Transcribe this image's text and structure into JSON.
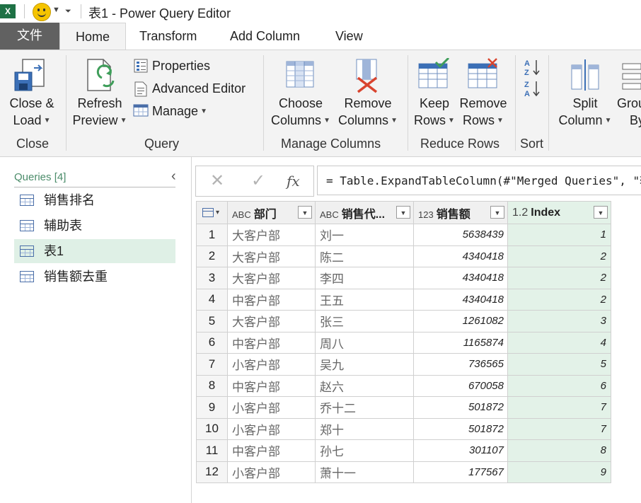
{
  "titlebar": {
    "app_icon": "X",
    "title": "表1 - Power Query Editor"
  },
  "tabs": {
    "file": "文件",
    "items": [
      "Home",
      "Transform",
      "Add Column",
      "View"
    ],
    "active": "Home"
  },
  "ribbon": {
    "close_load": [
      "Close &",
      "Load"
    ],
    "refresh_preview": [
      "Refresh",
      "Preview"
    ],
    "properties": "Properties",
    "advanced_editor": "Advanced Editor",
    "manage": "Manage",
    "choose_columns": [
      "Choose",
      "Columns"
    ],
    "remove_columns": [
      "Remove",
      "Columns"
    ],
    "keep_rows": [
      "Keep",
      "Rows"
    ],
    "remove_rows": [
      "Remove",
      "Rows"
    ],
    "split_column": [
      "Split",
      "Column"
    ],
    "group_by": [
      "Grou",
      "By"
    ],
    "groups": {
      "close": "Close",
      "query": "Query",
      "manage_columns": "Manage Columns",
      "reduce_rows": "Reduce Rows",
      "sort": "Sort"
    }
  },
  "queries": {
    "header": "Queries [4]",
    "items": [
      "销售排名",
      "辅助表",
      "表1",
      "销售额去重"
    ],
    "selected": "表1"
  },
  "formula": {
    "text": "= Table.ExpandTableColumn(#\"Merged Queries\", \"辅",
    "cancel": "✕",
    "confirm": "✓",
    "fx": "fx"
  },
  "grid": {
    "columns": [
      {
        "type": "ABC",
        "name": "部门"
      },
      {
        "type": "ABC",
        "name": "销售代..."
      },
      {
        "type": "123",
        "name": "销售额"
      },
      {
        "type": "1.2",
        "name": "Index"
      }
    ],
    "rows": [
      [
        "1",
        "大客户部",
        "刘一",
        "5638439",
        "1"
      ],
      [
        "2",
        "大客户部",
        "陈二",
        "4340418",
        "2"
      ],
      [
        "3",
        "大客户部",
        "李四",
        "4340418",
        "2"
      ],
      [
        "4",
        "中客户部",
        "王五",
        "4340418",
        "2"
      ],
      [
        "5",
        "大客户部",
        "张三",
        "1261082",
        "3"
      ],
      [
        "6",
        "中客户部",
        "周八",
        "1165874",
        "4"
      ],
      [
        "7",
        "小客户部",
        "吴九",
        "736565",
        "5"
      ],
      [
        "8",
        "中客户部",
        "赵六",
        "670058",
        "6"
      ],
      [
        "9",
        "小客户部",
        "乔十二",
        "501872",
        "7"
      ],
      [
        "10",
        "小客户部",
        "郑十",
        "501872",
        "7"
      ],
      [
        "11",
        "中客户部",
        "孙七",
        "301107",
        "8"
      ],
      [
        "12",
        "小客户部",
        "萧十一",
        "177567",
        "9"
      ]
    ]
  },
  "colors": {
    "file_tab": "#616161",
    "ribbon_bg": "#f3f3f3",
    "selected_query": "#dff0e6",
    "index_column": "#e3f2e8",
    "query_header": "#4b8c6a"
  }
}
